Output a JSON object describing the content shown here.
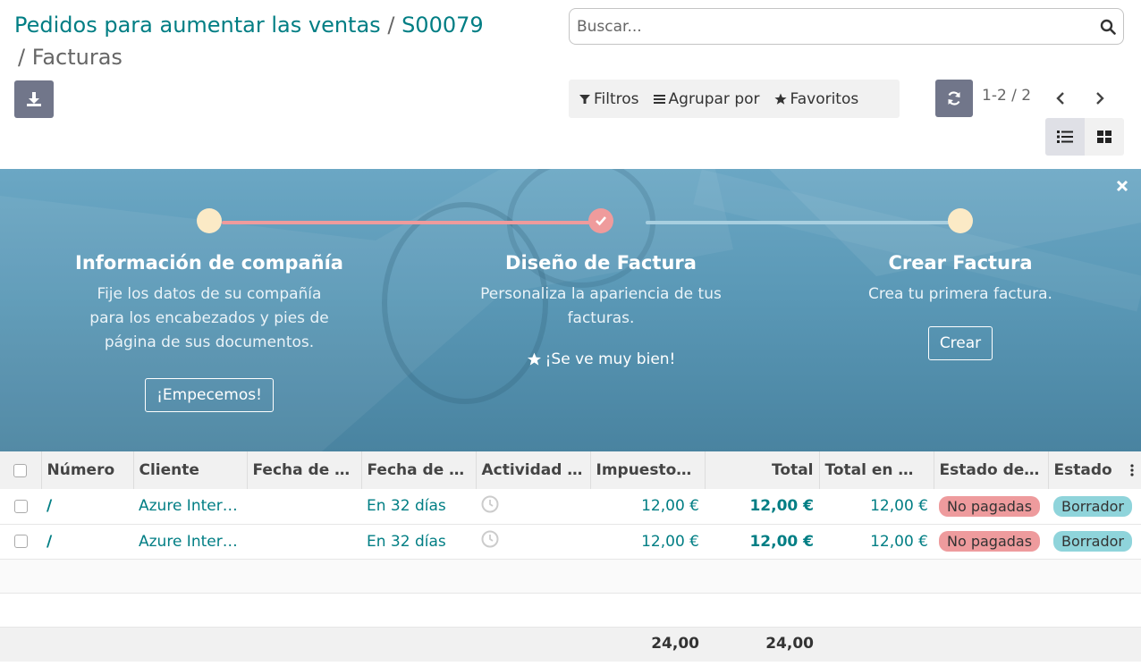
{
  "breadcrumb": {
    "parent": "Pedidos para aumentar las ventas",
    "order": "S00079",
    "separator": "/",
    "current": "Facturas"
  },
  "search": {
    "placeholder": "Buscar..."
  },
  "filters": {
    "filter_label": "Filtros",
    "group_label": "Agrupar por",
    "favorites_label": "Favoritos"
  },
  "pager": {
    "value": "1-2 / 2"
  },
  "onboarding": {
    "steps": [
      {
        "title": "Información de compañía",
        "description": "Fije los datos de su compañía para los encabezados y pies de página de sus documentos.",
        "button": "¡Empecemos!"
      },
      {
        "title": "Diseño de Factura",
        "description": "Personaliza la apariencia de tus facturas.",
        "done_message": "¡Se ve muy bien!"
      },
      {
        "title": "Crear Factura",
        "description": "Crea tu primera factura.",
        "button": "Crear"
      }
    ]
  },
  "table": {
    "columns": [
      "Número",
      "Cliente",
      "Fecha de factura",
      "Fecha de vencimiento",
      "Actividad siguiente",
      "Impuestos no incluidos",
      "Total",
      "Total en moneda",
      "Estado de pago",
      "Estado"
    ],
    "rows": [
      {
        "number": "/",
        "client": "Azure Interior",
        "invoice_date": "",
        "due_date": "En 32 días",
        "tax_excluded": "12,00 €",
        "total": "12,00 €",
        "total_currency": "12,00 €",
        "payment_state": "No pagadas",
        "state": "Borrador"
      },
      {
        "number": "/",
        "client": "Azure Interior",
        "invoice_date": "",
        "due_date": "En 32 días",
        "tax_excluded": "12,00 €",
        "total": "12,00 €",
        "total_currency": "12,00 €",
        "payment_state": "No pagadas",
        "state": "Borrador"
      }
    ],
    "totals": {
      "tax_excluded": "24,00",
      "total": "24,00"
    }
  },
  "colors": {
    "accent": "#017e84",
    "button_gray": "#71768a",
    "banner_blue": "#5a98b6",
    "progress_done": "#ef9b9c",
    "badge_unpaid": "#ee9b9d",
    "badge_draft": "#8fd4db"
  }
}
